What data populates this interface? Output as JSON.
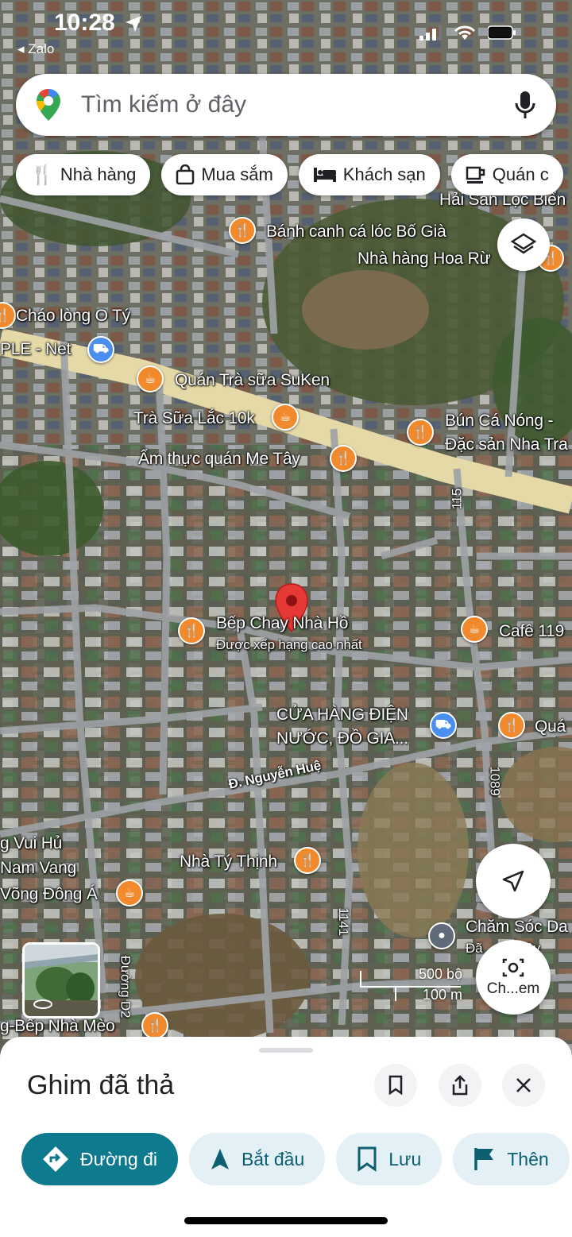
{
  "status": {
    "time": "10:28",
    "back_app": "◂ Zalo"
  },
  "search": {
    "placeholder": "Tìm kiếm ở đây"
  },
  "chips": [
    "Nhà hàng",
    "Mua sắm",
    "Khách sạn",
    "Quán c"
  ],
  "map": {
    "labels": {
      "hai_san": "Hải Sản Lộc Biển",
      "banh_canh": "Bánh canh cá lóc Bố Già",
      "nha_hang_hoa": "Nhà hàng Hoa Rừ",
      "chao_long": "Cháo lòng O Tý",
      "ple_net": "PLE - Net",
      "quan_tra_sua": "Quán Trà sữa SuKen",
      "tra_sua_lac": "Trà Sữa Lắc 10k",
      "bun_ca_1": "Bún Cá Nóng -",
      "bun_ca_2": "Đặc sản Nha Tra",
      "am_thuc": "Ẩm thực quán Me Tây",
      "road_115": "115",
      "bep_chay": "Bếp Chay Nhà Hồ",
      "bep_chay_sub": "Được xếp hạng cao nhất",
      "cafe": "Cafê 119",
      "cua_hang_1": "CỬA HÀNG ĐIỆN",
      "cua_hang_2": "NƯỚC, ĐỒ GIA...",
      "qua": "Quá",
      "nguyen_hue": "Đ. Nguyễn Huệ",
      "road_1089": "1089",
      "vui_hu": "g Vui Hủ",
      "nam_vang": "Nam Vang",
      "vong_dong_a": "Võng Đông Á",
      "nha_ty_thinh": "Nhà Tý Thịnh",
      "road_1141": "1141",
      "cham_soc": "Chăm Sóc Da",
      "cham_soc_sub": "Đã ... ần đây",
      "duong_d2": "Đường D2",
      "bep_nha_meo": "g-Bếp Nhà Mèo"
    },
    "scale": {
      "ft": "500 bộ",
      "m": "100 m"
    },
    "camera_label": "Ch...em"
  },
  "sheet": {
    "title": "Ghim đã thả",
    "actions": [
      "Đường đi",
      "Bắt đầu",
      "Lưu",
      "Thên"
    ]
  },
  "colors": {
    "accent": "#0e7a8e",
    "poi": "#f08a2c",
    "pin": "#e53935"
  }
}
